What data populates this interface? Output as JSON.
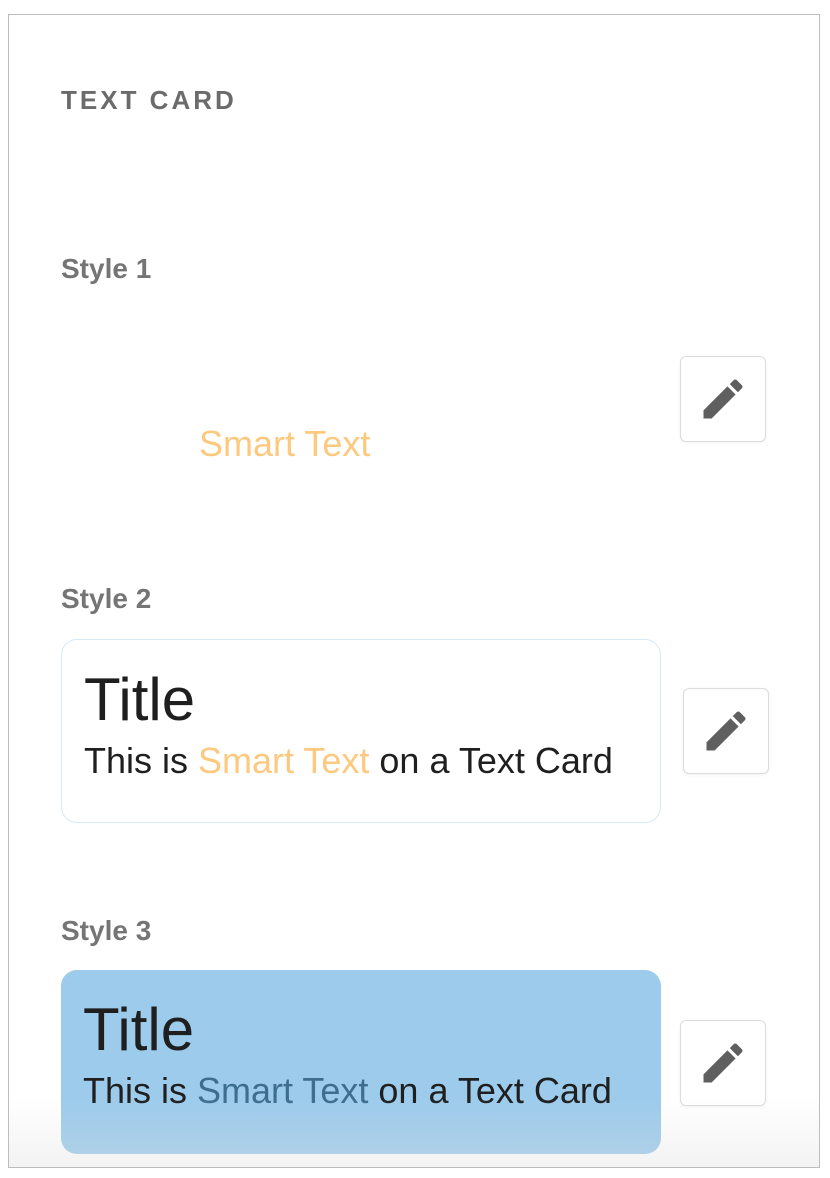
{
  "section": {
    "title": "TEXT CARD"
  },
  "styles": [
    {
      "label": "Style 1",
      "smart_text": "Smart Text",
      "edit_icon": "pencil-icon"
    },
    {
      "label": "Style 2",
      "card": {
        "title": "Title",
        "body_prefix": "This is ",
        "smart_text": "Smart Text",
        "body_suffix": " on a Text Card"
      },
      "edit_icon": "pencil-icon"
    },
    {
      "label": "Style 3",
      "card": {
        "title": "Title",
        "body_prefix": "This is ",
        "smart_text": "Smart Text",
        "body_suffix": " on a Text Card"
      },
      "edit_icon": "pencil-icon"
    }
  ],
  "colors": {
    "smart_text_orange": "#fcc97f",
    "smart_text_blue": "#3d6e8f",
    "card_fill": "#9ccbec",
    "card_outline": "#d8e9f7",
    "label_gray": "#757575",
    "icon_gray": "#5f5f5f"
  }
}
